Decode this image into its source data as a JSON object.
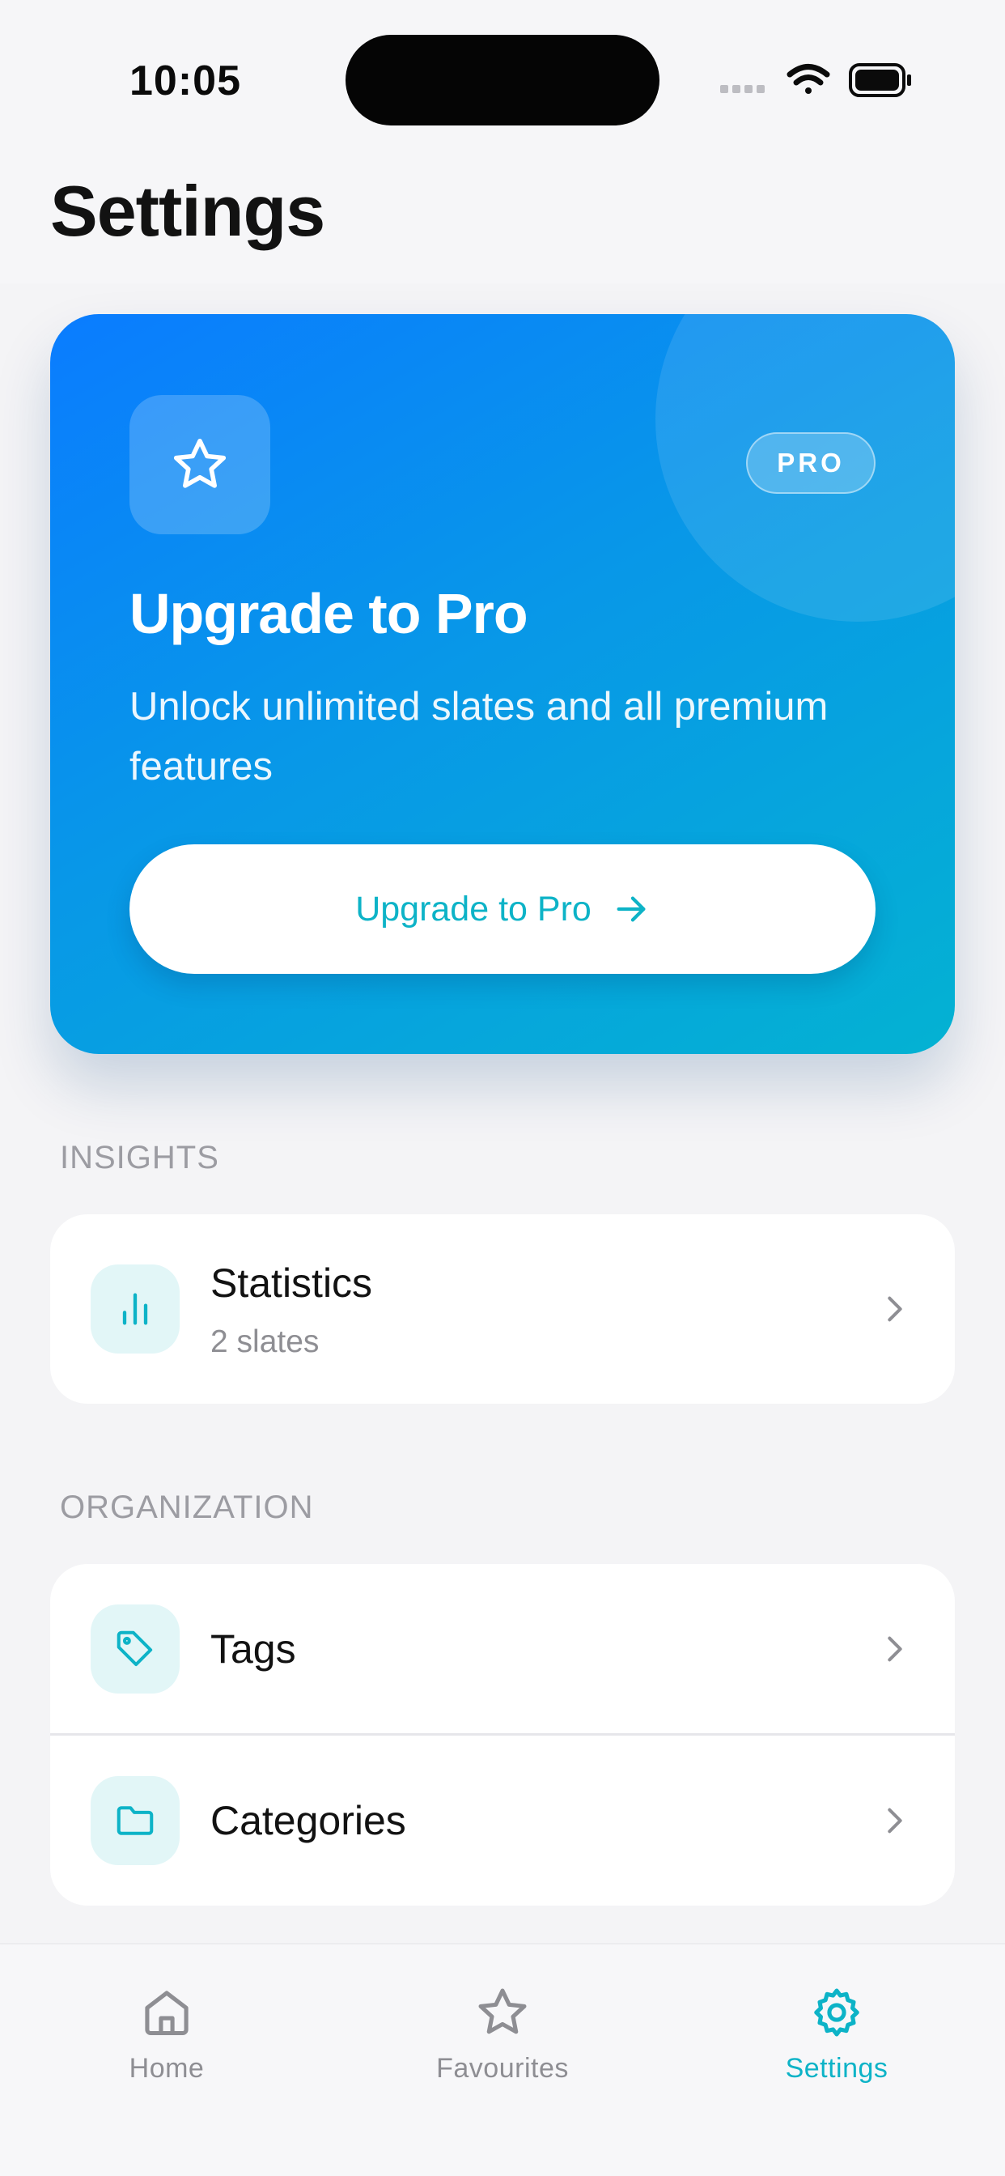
{
  "status_bar": {
    "time": "10:05"
  },
  "header": {
    "title": "Settings"
  },
  "promo": {
    "badge": "PRO",
    "title": "Upgrade to Pro",
    "description": "Unlock unlimited slates and all premium features",
    "button_label": "Upgrade to Pro",
    "icon": "star-icon",
    "button_icon": "arrow-right-icon"
  },
  "sections": {
    "insights": {
      "label": "INSIGHTS",
      "items": [
        {
          "title": "Statistics",
          "subtitle": "2 slates",
          "icon": "bar-chart-icon"
        }
      ]
    },
    "organization": {
      "label": "ORGANIZATION",
      "items": [
        {
          "title": "Tags",
          "icon": "tag-icon"
        },
        {
          "title": "Categories",
          "icon": "folder-icon"
        }
      ]
    }
  },
  "tab_bar": {
    "tabs": [
      {
        "label": "Home",
        "icon": "home-icon",
        "active": false
      },
      {
        "label": "Favourites",
        "icon": "star-icon",
        "active": false
      },
      {
        "label": "Settings",
        "icon": "gear-icon",
        "active": true
      }
    ]
  },
  "colors": {
    "accent": "#0DB3C7",
    "promo_gradient_start": "#0A7CFF",
    "promo_gradient_end": "#04B2D2",
    "background": "#F4F4F6"
  }
}
